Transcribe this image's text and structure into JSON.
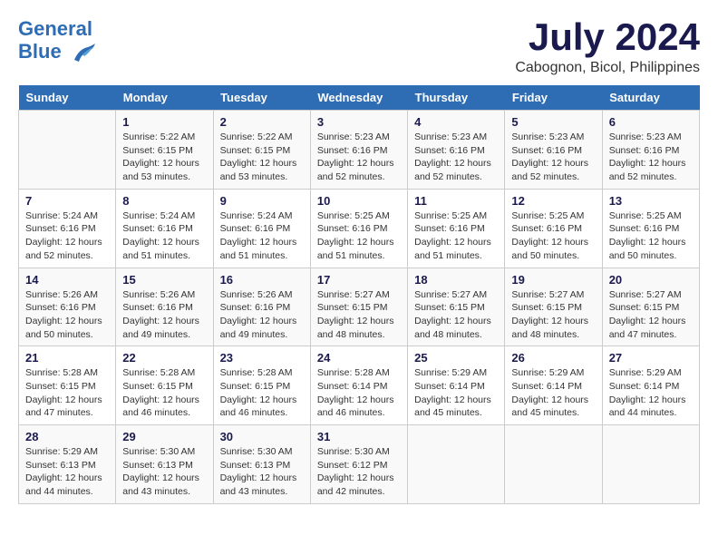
{
  "header": {
    "logo_line1": "General",
    "logo_line2": "Blue",
    "month": "July 2024",
    "location": "Cabognon, Bicol, Philippines"
  },
  "calendar": {
    "days_of_week": [
      "Sunday",
      "Monday",
      "Tuesday",
      "Wednesday",
      "Thursday",
      "Friday",
      "Saturday"
    ],
    "weeks": [
      [
        {
          "day": "",
          "info": ""
        },
        {
          "day": "1",
          "info": "Sunrise: 5:22 AM\nSunset: 6:15 PM\nDaylight: 12 hours\nand 53 minutes."
        },
        {
          "day": "2",
          "info": "Sunrise: 5:22 AM\nSunset: 6:15 PM\nDaylight: 12 hours\nand 53 minutes."
        },
        {
          "day": "3",
          "info": "Sunrise: 5:23 AM\nSunset: 6:16 PM\nDaylight: 12 hours\nand 52 minutes."
        },
        {
          "day": "4",
          "info": "Sunrise: 5:23 AM\nSunset: 6:16 PM\nDaylight: 12 hours\nand 52 minutes."
        },
        {
          "day": "5",
          "info": "Sunrise: 5:23 AM\nSunset: 6:16 PM\nDaylight: 12 hours\nand 52 minutes."
        },
        {
          "day": "6",
          "info": "Sunrise: 5:23 AM\nSunset: 6:16 PM\nDaylight: 12 hours\nand 52 minutes."
        }
      ],
      [
        {
          "day": "7",
          "info": "Sunrise: 5:24 AM\nSunset: 6:16 PM\nDaylight: 12 hours\nand 52 minutes."
        },
        {
          "day": "8",
          "info": "Sunrise: 5:24 AM\nSunset: 6:16 PM\nDaylight: 12 hours\nand 51 minutes."
        },
        {
          "day": "9",
          "info": "Sunrise: 5:24 AM\nSunset: 6:16 PM\nDaylight: 12 hours\nand 51 minutes."
        },
        {
          "day": "10",
          "info": "Sunrise: 5:25 AM\nSunset: 6:16 PM\nDaylight: 12 hours\nand 51 minutes."
        },
        {
          "day": "11",
          "info": "Sunrise: 5:25 AM\nSunset: 6:16 PM\nDaylight: 12 hours\nand 51 minutes."
        },
        {
          "day": "12",
          "info": "Sunrise: 5:25 AM\nSunset: 6:16 PM\nDaylight: 12 hours\nand 50 minutes."
        },
        {
          "day": "13",
          "info": "Sunrise: 5:25 AM\nSunset: 6:16 PM\nDaylight: 12 hours\nand 50 minutes."
        }
      ],
      [
        {
          "day": "14",
          "info": "Sunrise: 5:26 AM\nSunset: 6:16 PM\nDaylight: 12 hours\nand 50 minutes."
        },
        {
          "day": "15",
          "info": "Sunrise: 5:26 AM\nSunset: 6:16 PM\nDaylight: 12 hours\nand 49 minutes."
        },
        {
          "day": "16",
          "info": "Sunrise: 5:26 AM\nSunset: 6:16 PM\nDaylight: 12 hours\nand 49 minutes."
        },
        {
          "day": "17",
          "info": "Sunrise: 5:27 AM\nSunset: 6:15 PM\nDaylight: 12 hours\nand 48 minutes."
        },
        {
          "day": "18",
          "info": "Sunrise: 5:27 AM\nSunset: 6:15 PM\nDaylight: 12 hours\nand 48 minutes."
        },
        {
          "day": "19",
          "info": "Sunrise: 5:27 AM\nSunset: 6:15 PM\nDaylight: 12 hours\nand 48 minutes."
        },
        {
          "day": "20",
          "info": "Sunrise: 5:27 AM\nSunset: 6:15 PM\nDaylight: 12 hours\nand 47 minutes."
        }
      ],
      [
        {
          "day": "21",
          "info": "Sunrise: 5:28 AM\nSunset: 6:15 PM\nDaylight: 12 hours\nand 47 minutes."
        },
        {
          "day": "22",
          "info": "Sunrise: 5:28 AM\nSunset: 6:15 PM\nDaylight: 12 hours\nand 46 minutes."
        },
        {
          "day": "23",
          "info": "Sunrise: 5:28 AM\nSunset: 6:15 PM\nDaylight: 12 hours\nand 46 minutes."
        },
        {
          "day": "24",
          "info": "Sunrise: 5:28 AM\nSunset: 6:14 PM\nDaylight: 12 hours\nand 46 minutes."
        },
        {
          "day": "25",
          "info": "Sunrise: 5:29 AM\nSunset: 6:14 PM\nDaylight: 12 hours\nand 45 minutes."
        },
        {
          "day": "26",
          "info": "Sunrise: 5:29 AM\nSunset: 6:14 PM\nDaylight: 12 hours\nand 45 minutes."
        },
        {
          "day": "27",
          "info": "Sunrise: 5:29 AM\nSunset: 6:14 PM\nDaylight: 12 hours\nand 44 minutes."
        }
      ],
      [
        {
          "day": "28",
          "info": "Sunrise: 5:29 AM\nSunset: 6:13 PM\nDaylight: 12 hours\nand 44 minutes."
        },
        {
          "day": "29",
          "info": "Sunrise: 5:30 AM\nSunset: 6:13 PM\nDaylight: 12 hours\nand 43 minutes."
        },
        {
          "day": "30",
          "info": "Sunrise: 5:30 AM\nSunset: 6:13 PM\nDaylight: 12 hours\nand 43 minutes."
        },
        {
          "day": "31",
          "info": "Sunrise: 5:30 AM\nSunset: 6:12 PM\nDaylight: 12 hours\nand 42 minutes."
        },
        {
          "day": "",
          "info": ""
        },
        {
          "day": "",
          "info": ""
        },
        {
          "day": "",
          "info": ""
        }
      ]
    ]
  }
}
